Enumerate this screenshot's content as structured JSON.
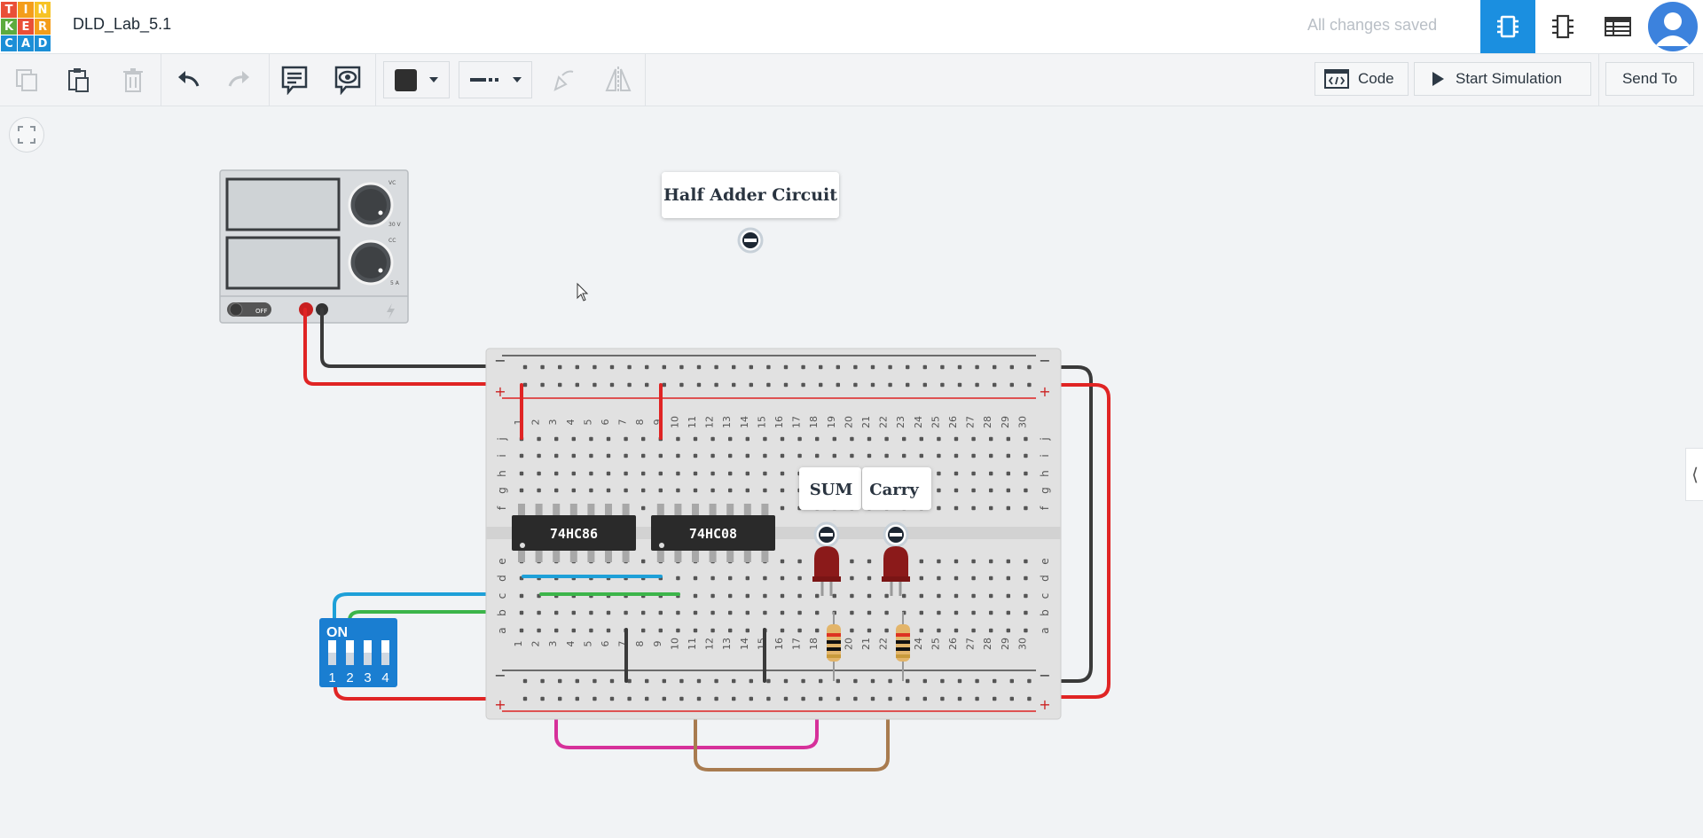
{
  "app": {
    "logo_letters": [
      "T",
      "I",
      "N",
      "K",
      "E",
      "R",
      "C",
      "A",
      "D"
    ],
    "logo_colors": [
      "#e94f37",
      "#f49d1a",
      "#f7c325",
      "#5dab3f",
      "#e94f37",
      "#f49d1a",
      "#1c8fd7",
      "#1c8fd7",
      "#1c8fd7"
    ],
    "document_title": "DLD_Lab_5.1",
    "save_status": "All changes saved",
    "views": [
      {
        "name": "circuit-view",
        "active": true
      },
      {
        "name": "schematic-view",
        "active": false
      },
      {
        "name": "component-list-view",
        "active": false
      }
    ]
  },
  "toolbar": {
    "icons": [
      "copy-icon",
      "paste-icon",
      "delete-icon",
      "undo-icon",
      "redo-icon",
      "notes-icon",
      "notes-visibility-icon",
      "color-picker",
      "wire-type-picker",
      "rotate-icon",
      "flip-icon"
    ],
    "code_label": "Code",
    "simulate_label": "Start Simulation",
    "send_label": "Send To"
  },
  "canvas": {
    "note_title": "Half Adder Circuit",
    "led_labels": [
      "SUM",
      "Carry"
    ],
    "chips": [
      "74HC86",
      "74HC08"
    ],
    "dip_switch": {
      "label": "ON",
      "numbers": [
        "1",
        "2",
        "3",
        "4"
      ]
    },
    "power_supply": {
      "switch_text": "OFF",
      "scale_top": "30 V",
      "scale_bottom": "5 A",
      "mode_top": "VC",
      "mode_bottom": "CC"
    },
    "breadboard": {
      "columns": [
        "1",
        "2",
        "3",
        "4",
        "5",
        "6",
        "7",
        "8",
        "9",
        "10",
        "11",
        "12",
        "13",
        "14",
        "15",
        "16",
        "17",
        "18",
        "19",
        "20",
        "21",
        "22",
        "23",
        "24",
        "25",
        "26",
        "27",
        "28",
        "29",
        "30"
      ],
      "rows_top": [
        "j",
        "i",
        "h",
        "g",
        "f"
      ],
      "rows_bottom": [
        "e",
        "d",
        "c",
        "b",
        "a"
      ],
      "rail_minus": "−",
      "rail_plus": "+"
    },
    "wire_colors": {
      "red": "#e02424",
      "black": "#3a3a3a",
      "blue": "#1ea0d8",
      "green": "#3cb54a",
      "magenta": "#d6309a",
      "brown": "#a87b4f"
    }
  }
}
